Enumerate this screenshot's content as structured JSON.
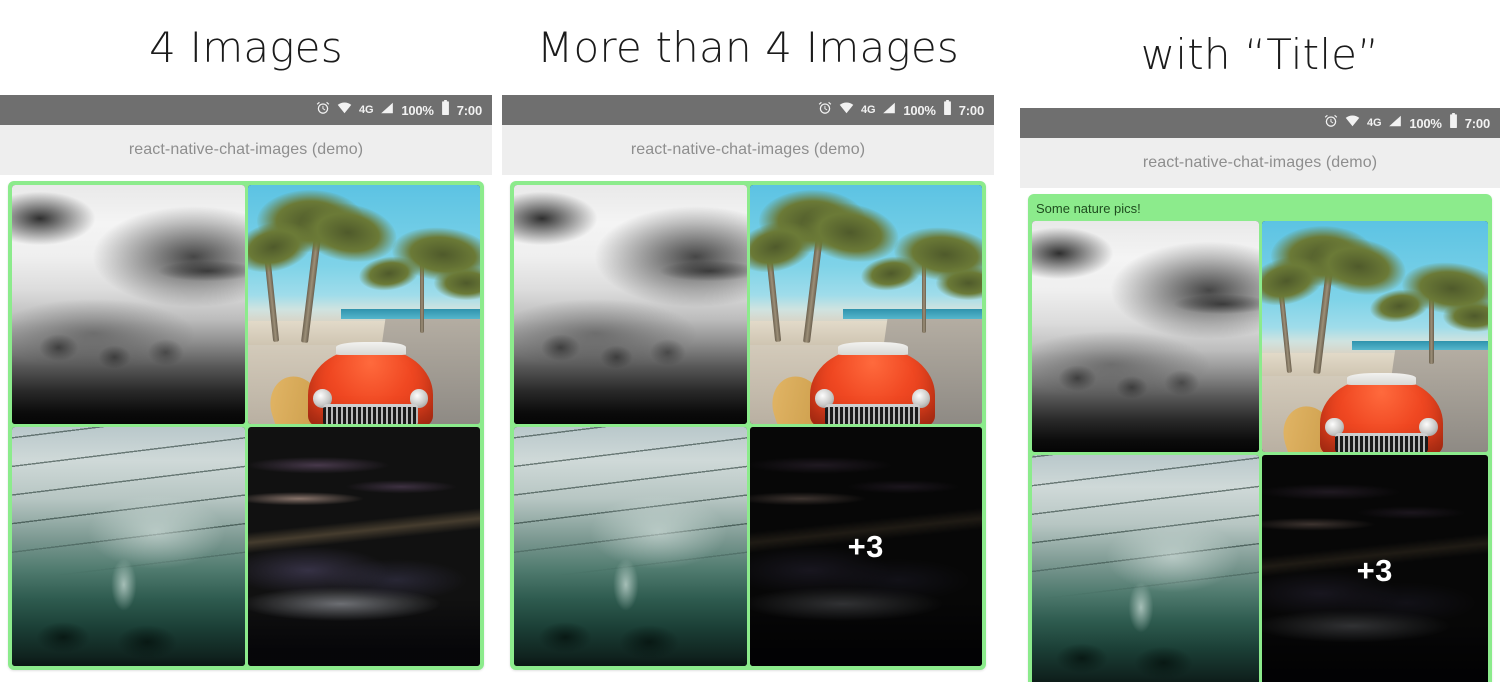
{
  "panels": [
    {
      "heading": "4 Images",
      "statusbar": {
        "alarm_icon": "alarm-clock-icon",
        "wifi_icon": "wifi-icon",
        "network_label": "4G",
        "signal_icon": "signal-bars-icon",
        "battery_percent": "100%",
        "battery_icon": "battery-full-icon",
        "clock": "7:00"
      },
      "appbar_title": "react-native-chat-images (demo)",
      "bubble": {
        "title": null,
        "images": [
          {
            "name": "misty-mountain-photo",
            "alt": "Black and white misty mountain forest",
            "art": "art-mist"
          },
          {
            "name": "palm-beach-car-photo",
            "alt": "Red vintage convertible under palm trees",
            "art": "art-palm"
          },
          {
            "name": "green-valley-photo",
            "alt": "Teal misty valley with power lines",
            "art": "art-valley"
          },
          {
            "name": "sunset-mountains-photo",
            "alt": "Pink sunset over layered mountains",
            "art": "art-sunset"
          }
        ],
        "overflow_label": null
      }
    },
    {
      "heading": "More than 4 Images",
      "statusbar": {
        "alarm_icon": "alarm-clock-icon",
        "wifi_icon": "wifi-icon",
        "network_label": "4G",
        "signal_icon": "signal-bars-icon",
        "battery_percent": "100%",
        "battery_icon": "battery-full-icon",
        "clock": "7:00"
      },
      "appbar_title": "react-native-chat-images (demo)",
      "bubble": {
        "title": null,
        "images": [
          {
            "name": "misty-mountain-photo",
            "alt": "Black and white misty mountain forest",
            "art": "art-mist"
          },
          {
            "name": "palm-beach-car-photo",
            "alt": "Red vintage convertible under palm trees",
            "art": "art-palm"
          },
          {
            "name": "green-valley-photo",
            "alt": "Teal misty valley with power lines",
            "art": "art-valley"
          },
          {
            "name": "sunset-mountains-photo",
            "alt": "Pink sunset over layered mountains",
            "art": "art-sunset"
          }
        ],
        "overflow_label": "+3"
      }
    },
    {
      "heading": "with “Title”",
      "statusbar": {
        "alarm_icon": "alarm-clock-icon",
        "wifi_icon": "wifi-icon",
        "network_label": "4G",
        "signal_icon": "signal-bars-icon",
        "battery_percent": "100%",
        "battery_icon": "battery-full-icon",
        "clock": "7:00"
      },
      "appbar_title": "react-native-chat-images (demo)",
      "bubble": {
        "title": "Some nature pics!",
        "images": [
          {
            "name": "misty-mountain-photo",
            "alt": "Black and white misty mountain forest",
            "art": "art-mist"
          },
          {
            "name": "palm-beach-car-photo",
            "alt": "Red vintage convertible under palm trees",
            "art": "art-palm"
          },
          {
            "name": "green-valley-photo",
            "alt": "Teal misty valley with power lines",
            "art": "art-valley"
          },
          {
            "name": "sunset-mountains-photo",
            "alt": "Pink sunset over layered mountains",
            "art": "art-sunset"
          }
        ],
        "overflow_label": "+3"
      }
    }
  ],
  "colors": {
    "bubble_green": "#8ceb8c",
    "statusbar_gray": "#6f6f6f",
    "appbar_gray": "#eeeeee",
    "appbar_text": "#8e8e8e",
    "bubble_title_text": "#1f4d1f",
    "overflow_text": "#ffffff",
    "page_background": "#ffffff"
  }
}
